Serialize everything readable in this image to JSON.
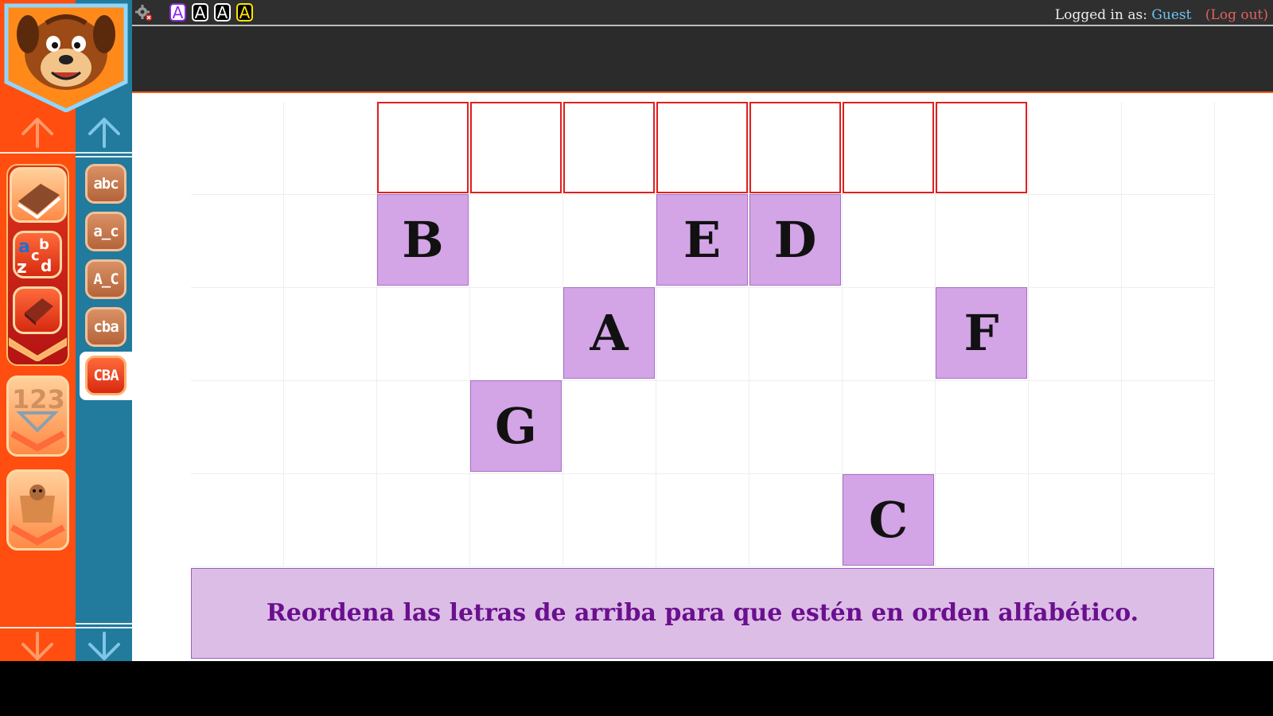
{
  "app": {
    "font_buttons": [
      "A",
      "A",
      "A",
      "A"
    ],
    "user": {
      "label": "Logged in as:",
      "name": "Guest",
      "logout": "(Log out)"
    }
  },
  "sidebar": {
    "categories": [
      {
        "name": "reading",
        "icon": "book-icon"
      },
      {
        "name": "alphabet",
        "icon": "abc-letters-icon",
        "text": "abcdz"
      },
      {
        "name": "library",
        "icon": "closed-book-icon"
      },
      {
        "name": "numbers",
        "icon": "numbers-icon",
        "text": "123"
      },
      {
        "name": "animals",
        "icon": "box-character-icon"
      }
    ],
    "activities": [
      {
        "label": "abc"
      },
      {
        "label": "a_c"
      },
      {
        "label": "A_C"
      },
      {
        "label": "cba"
      },
      {
        "label": "CBA",
        "active": true
      }
    ]
  },
  "game": {
    "slots_count": 7,
    "tiles": [
      {
        "letter": "B"
      },
      {
        "letter": "E"
      },
      {
        "letter": "D"
      },
      {
        "letter": "A"
      },
      {
        "letter": "F"
      },
      {
        "letter": "G"
      },
      {
        "letter": "C"
      }
    ],
    "instruction": "Reordena las letras de arriba para que estén en orden alfabético."
  },
  "colors": {
    "orange_panel": "#ff4e0f",
    "blue_panel": "#227a9d",
    "tile": "#d3a4e6",
    "slot_border": "#e02020",
    "instruction_text": "#6a0f8e"
  }
}
